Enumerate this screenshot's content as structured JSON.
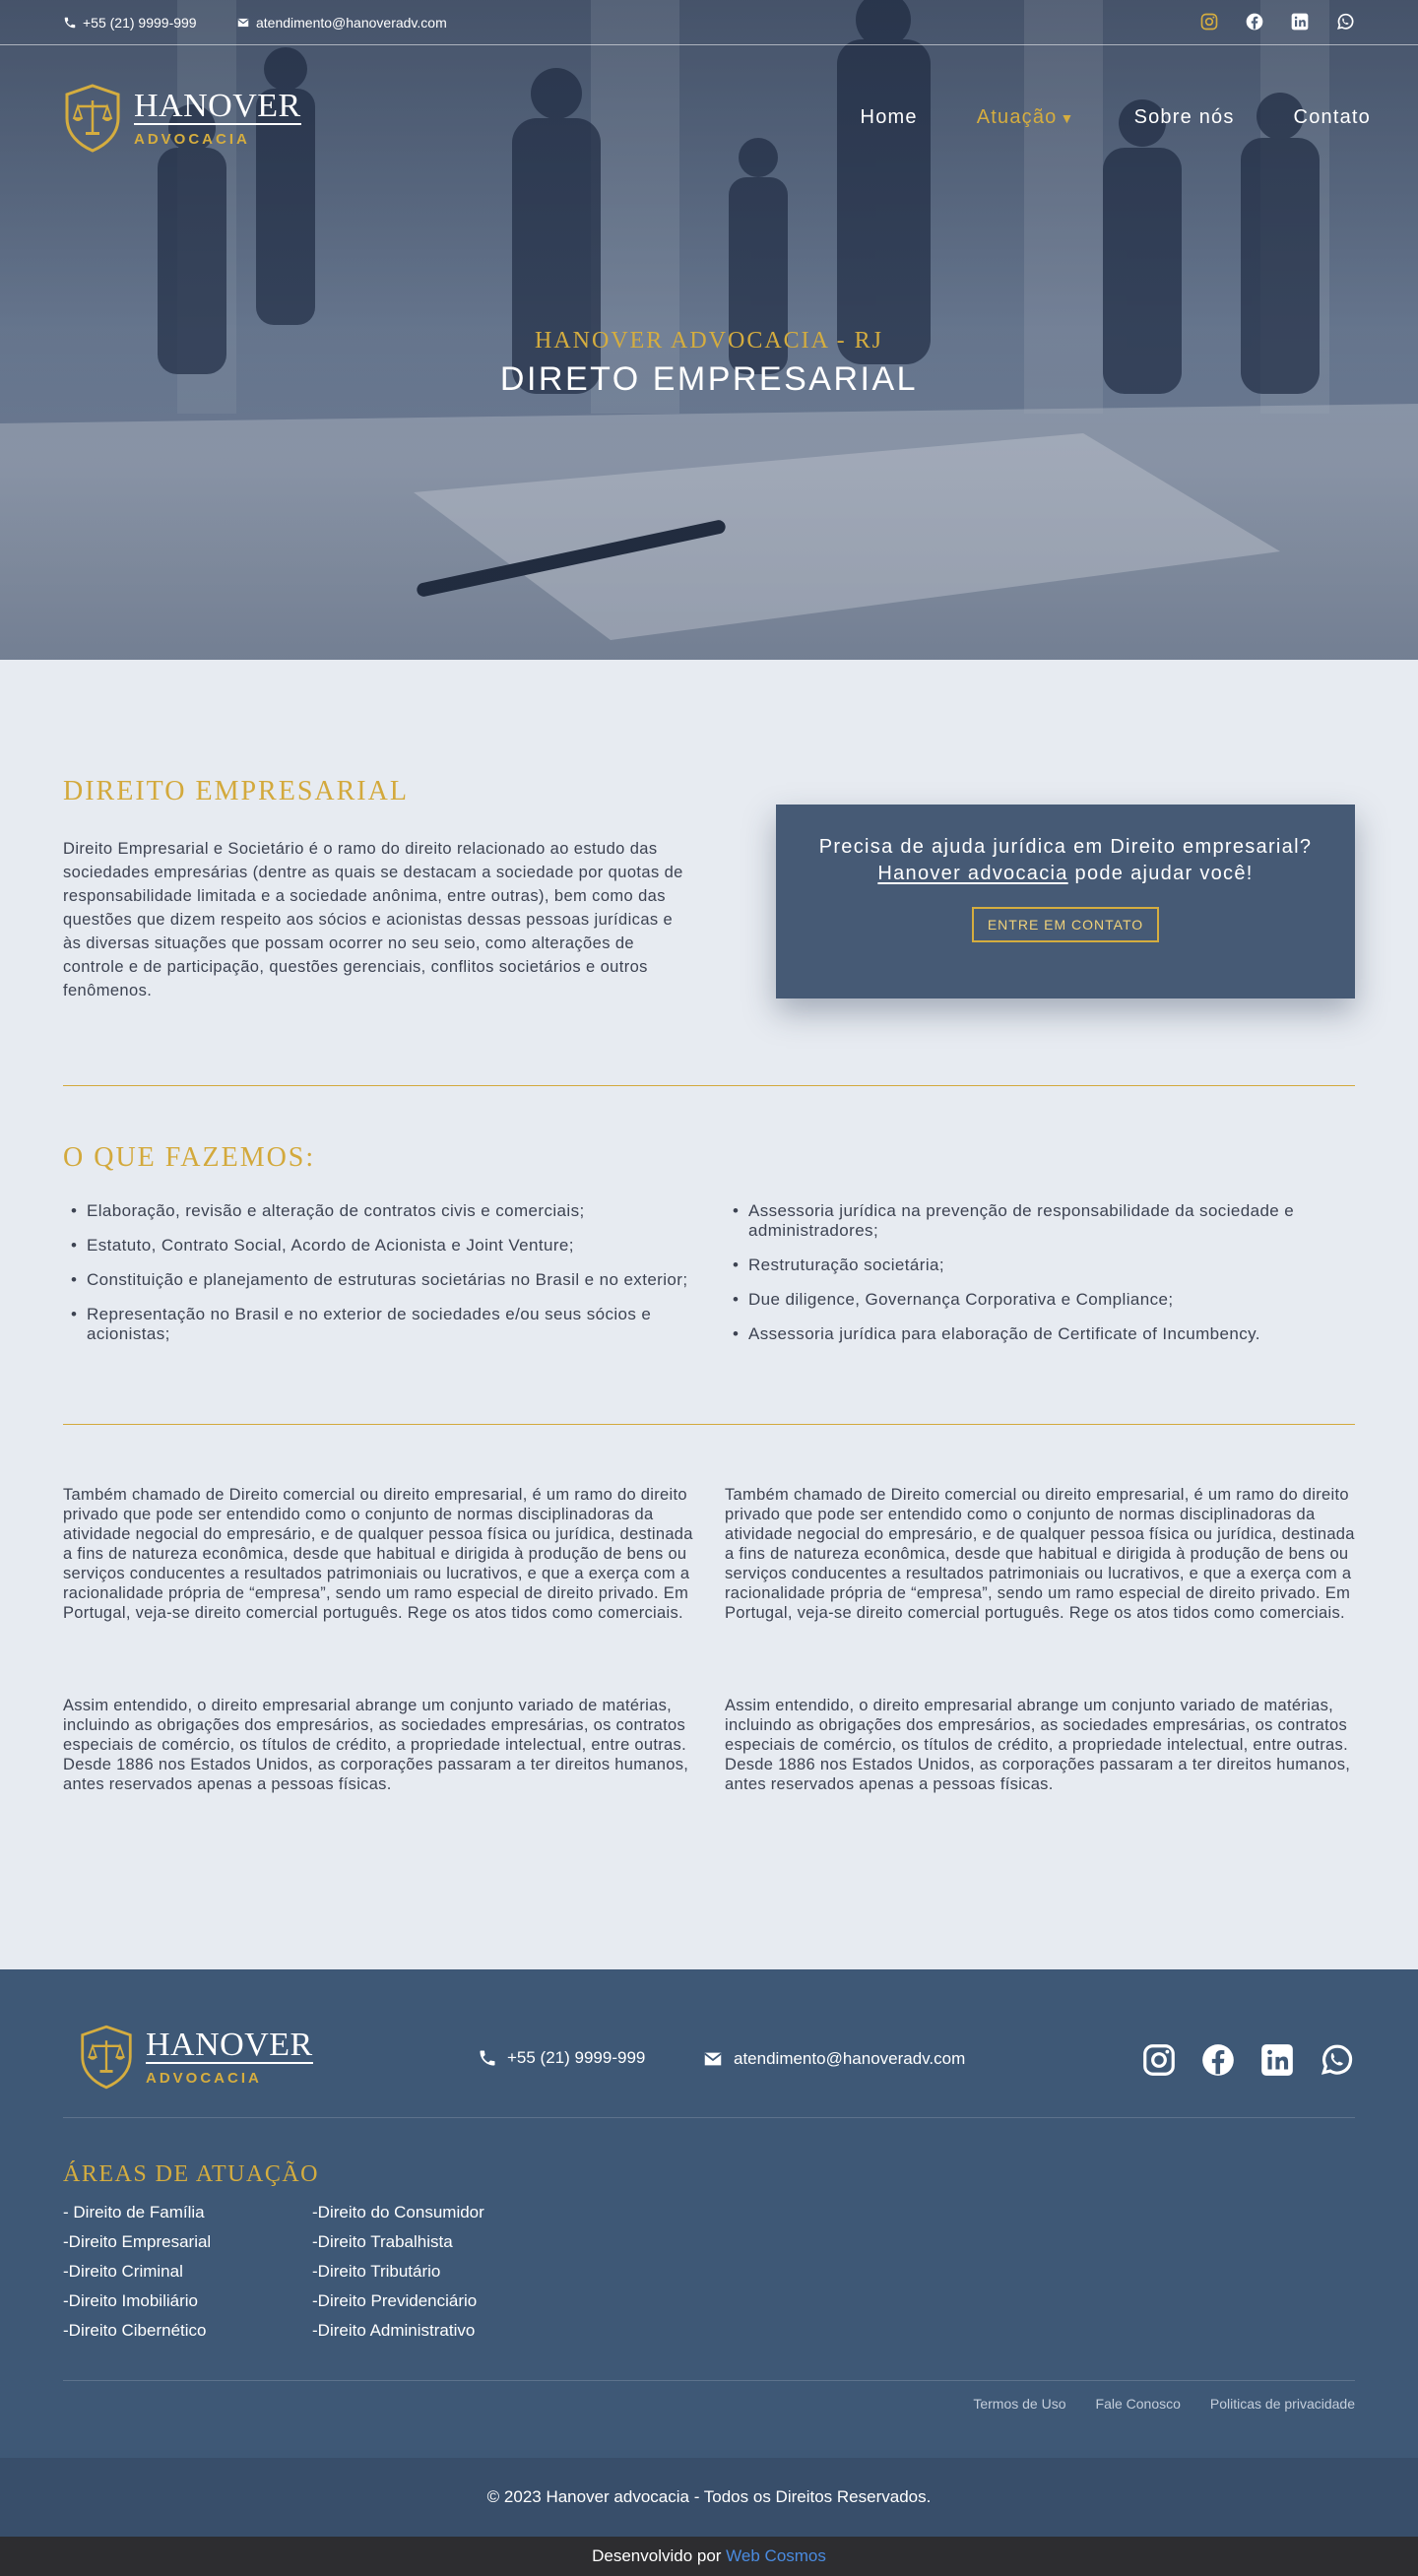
{
  "colors": {
    "gold": "#d3a93c",
    "navy": "#3e5876",
    "cta": "#465a75",
    "page_bg": "#e7ebf1",
    "dev_link": "#4a8be0"
  },
  "topbar": {
    "phone": "+55 (21) 9999-999",
    "email": "atendimento@hanoveradv.com",
    "socials": [
      "instagram-icon",
      "facebook-icon",
      "linkedin-icon",
      "whatsapp-icon"
    ]
  },
  "logo": {
    "brand": "HANOVER",
    "sub": "ADVOCACIA",
    "emblem": "scales-of-justice-shield-icon"
  },
  "nav": {
    "home": "Home",
    "atuacao": "Atuação",
    "sobre": "Sobre nós",
    "contato": "Contato"
  },
  "hero": {
    "kicker": "HANOVER ADVOCACIA - RJ",
    "title": "DIRETO EMPRESARIAL"
  },
  "intro": {
    "title": "DIREITO EMPRESARIAL",
    "text": "Direito Empresarial e Societário é o ramo do direito relacionado ao estudo das sociedades empresárias (dentre as quais se destacam a sociedade por quotas de responsabilidade limitada e a sociedade anônima, entre outras), bem como das questões que dizem respeito aos sócios e acionistas dessas pessoas jurídicas e às diversas situações que possam ocorrer no seu seio, como alterações de controle e de participação, questões gerenciais, conflitos societários e outros fenômenos."
  },
  "cta": {
    "question_pre": "Precisa de ajuda jurídica em Direito empresarial?",
    "question_link": "Hanover advocacia",
    "question_post": " pode ajudar você!",
    "button": "ENTRE EM CONTATO"
  },
  "services": {
    "title": "O QUE FAZEMOS:",
    "left": [
      "Elaboração, revisão e alteração de contratos civis e comerciais;",
      "Estatuto, Contrato Social, Acordo de Acionista e Joint Venture;",
      "Constituição e planejamento de estruturas societárias no Brasil e no exterior;",
      "Representação no Brasil e no exterior de sociedades e/ou seus sócios e acionistas;"
    ],
    "right": [
      "Assessoria jurídica na prevenção de responsabilidade da sociedade e administradores;",
      "Restruturação societária;",
      "Due diligence, Governança Corporativa e Compliance;",
      "Assessoria jurídica para elaboração de Certificate of Incumbency."
    ]
  },
  "details": {
    "p1": "Também chamado de Direito comercial ou direito empresarial, é um ramo do direito privado que pode ser entendido como o conjunto de normas disciplinadoras da atividade negocial do empresário, e de qualquer pessoa física ou jurídica, destinada a fins de natureza econômica, desde que habitual e dirigida à produção de bens ou serviços conducentes a resultados patrimoniais ou lucrativos, e que a exerça com a racionalidade própria de “empresa”, sendo um ramo especial de direito privado. Em Portugal, veja-se direito comercial português. Rege os atos tidos como comerciais.",
    "p2": "Assim entendido, o direito empresarial abrange um conjunto variado de matérias, incluindo as obrigações dos empresários, as sociedades empresárias, os contratos especiais de comércio, os títulos de crédito, a propriedade intelectual, entre outras. Desde 1886 nos Estados Unidos, as corporações passaram a ter direitos humanos, antes reservados apenas a pessoas físicas."
  },
  "footer": {
    "phone": "+55 (21) 9999-999",
    "email": "atendimento@hanoveradv.com",
    "areas_title": "ÁREAS DE ATUAÇÃO",
    "areas_left": [
      "- Direito de Família",
      "-Direito Empresarial",
      "-Direito Criminal",
      "-Direito Imobiliário",
      "-Direito Cibernético"
    ],
    "areas_right": [
      "-Direito do Consumidor",
      "-Direito Trabalhista",
      "-Direito Tributário",
      "-Direito Previdenciário",
      "-Direito Administrativo"
    ],
    "legal": [
      "Termos de Uso",
      "Fale Conosco",
      "Politicas de privacidade"
    ],
    "copyright": "© 2023 Hanover advocacia - Todos os Direitos Reservados.",
    "dev_prefix": "Desenvolvido por ",
    "dev_link": "Web Cosmos"
  }
}
